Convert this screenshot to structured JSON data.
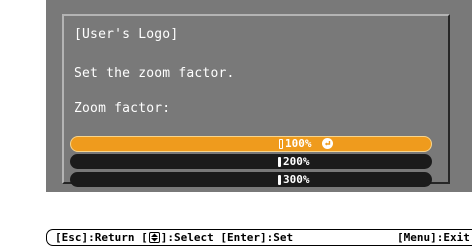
{
  "dialog": {
    "title": "[User's Logo]",
    "instruction": "Set the zoom factor.",
    "field_label": "Zoom factor:",
    "options": [
      {
        "label": "100%",
        "selected": true
      },
      {
        "label": "200%",
        "selected": false
      },
      {
        "label": "300%",
        "selected": false
      }
    ]
  },
  "footer": {
    "esc_label": "[Esc]:Return [",
    "select_label": "]:Select [Enter]:Set",
    "menu_label": "[Menu]:Exit"
  },
  "colors": {
    "panel_background": "#797979",
    "selected_option": "#ef9b1d",
    "option_background": "#1b1b1b"
  },
  "icons": {
    "enter": "enter-icon",
    "select": "updown-icon"
  }
}
